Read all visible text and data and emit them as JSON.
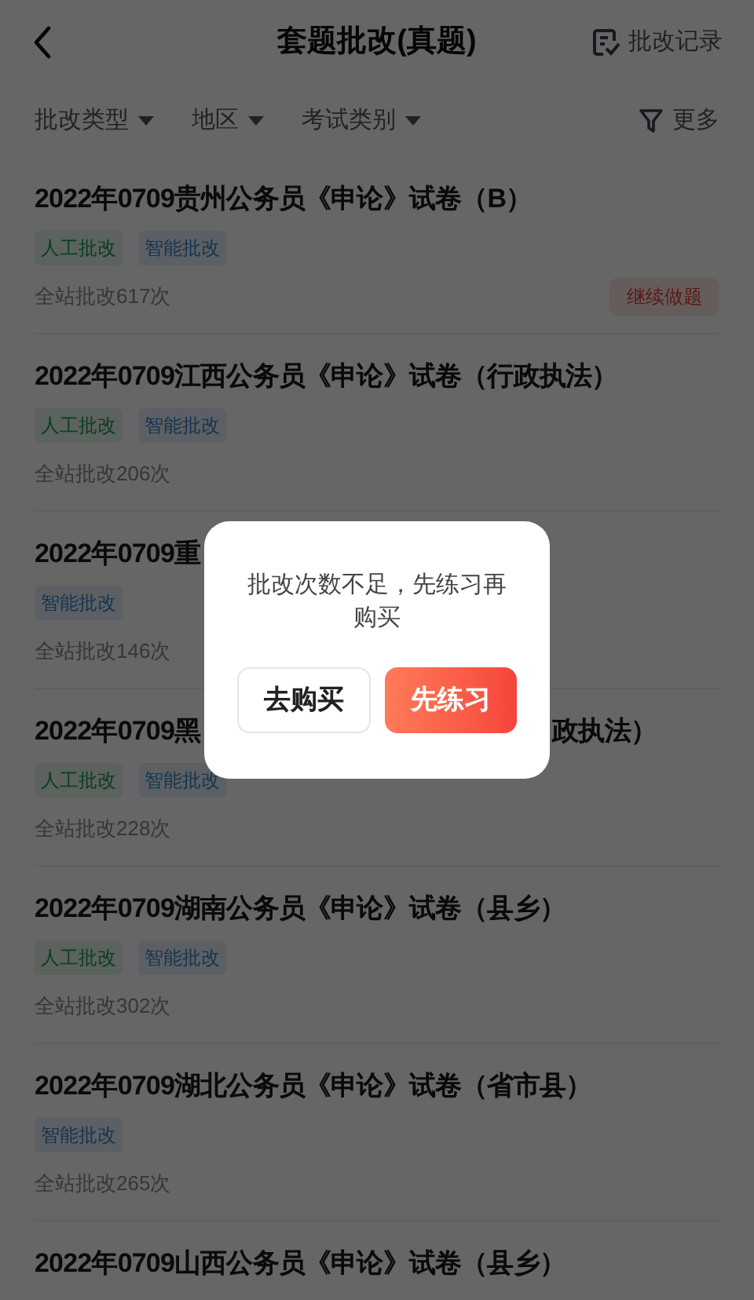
{
  "header": {
    "title": "套题批改(真题)",
    "record_link": "批改记录"
  },
  "filters": {
    "items": [
      {
        "label": "批改类型"
      },
      {
        "label": "地区"
      },
      {
        "label": "考试类别"
      }
    ],
    "more": "更多"
  },
  "papers": [
    {
      "title_parts": [
        "2022年0709贵州公务员《申论》试卷（B）"
      ],
      "tags": [
        {
          "kind": "manual",
          "label": "人工批改"
        },
        {
          "kind": "ai",
          "label": "智能批改"
        }
      ],
      "count": "全站批改617次",
      "action": "继续做题"
    },
    {
      "title_parts": [
        "2022年0709江西公务员《申论》试卷（行政执法）"
      ],
      "tags": [
        {
          "kind": "manual",
          "label": "人工批改"
        },
        {
          "kind": "ai",
          "label": "智能批改"
        }
      ],
      "count": "全站批改206次"
    },
    {
      "title_parts": [
        "2022年0709重"
      ],
      "tags": [
        {
          "kind": "ai",
          "label": "智能批改"
        }
      ],
      "count": "全站批改146次"
    },
    {
      "title_parts": [
        "2022年0709黑",
        "政执法）"
      ],
      "tags": [
        {
          "kind": "manual",
          "label": "人工批改"
        },
        {
          "kind": "ai",
          "label": "智能批改"
        }
      ],
      "count": "全站批改228次"
    },
    {
      "title_parts": [
        "2022年0709湖南公务员《申论》试卷（县乡）"
      ],
      "tags": [
        {
          "kind": "manual",
          "label": "人工批改"
        },
        {
          "kind": "ai",
          "label": "智能批改"
        }
      ],
      "count": "全站批改302次"
    },
    {
      "title_parts": [
        "2022年0709湖北公务员《申论》试卷（省市县）"
      ],
      "tags": [
        {
          "kind": "ai",
          "label": "智能批改"
        }
      ],
      "count": "全站批改265次"
    },
    {
      "title_parts": [
        "2022年0709山西公务员《申论》试卷（县乡）"
      ]
    }
  ],
  "dialog": {
    "message": "批改次数不足，先练习再购买",
    "buttons": [
      {
        "kind": "secondary",
        "label": "去购买"
      },
      {
        "kind": "primary",
        "label": "先练习"
      }
    ]
  }
}
